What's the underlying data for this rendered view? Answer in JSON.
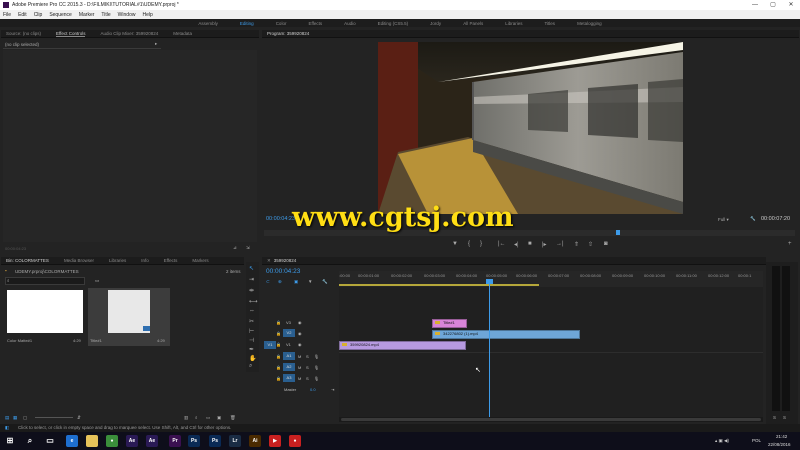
{
  "window": {
    "title": "Adobe Premiere Pro CC 2015.3 - D:\\FILMIKI\\TUTORIAL#1\\UDEMY.prproj *",
    "controls": [
      "—",
      "▢",
      "✕"
    ]
  },
  "menu": [
    "File",
    "Edit",
    "Clip",
    "Sequence",
    "Marker",
    "Title",
    "Window",
    "Help"
  ],
  "workspaces": {
    "items": [
      "Assembly",
      "Editing",
      "Color",
      "Effects",
      "Audio",
      "Editing (CS5.5)",
      "Jordy",
      "All Panels",
      "Libraries",
      "Titles",
      "Metalogging"
    ],
    "active": "Editing"
  },
  "source_panel": {
    "tabs": [
      "Source: (no clips)",
      "Effect Controls",
      "Audio Clip Mixer: 359920824",
      "Metadata"
    ],
    "active_tab": "Effect Controls",
    "no_clip": "(no clip selected)",
    "timecode": "00:00:04:23"
  },
  "program_panel": {
    "title": "Program: 359920824",
    "timecode_left": "00:00:04:23",
    "fit": "Full",
    "timecode_right": "00:00:07:20",
    "playhead_fraction": 0.667
  },
  "watermark": "www.cgtsj.com",
  "project_panel": {
    "tabs": [
      "Bin: COLORMATTES",
      "Media Browser",
      "Libraries",
      "Info",
      "Effects",
      "Markers"
    ],
    "active_tab": "Bin: COLORMATTES",
    "path": "UDEMY.prproj\\COLORMATTES",
    "count": "2 items",
    "items": [
      {
        "name": "Color Matte#1",
        "duration": "4:29"
      },
      {
        "name": "Title#1",
        "duration": "4:29"
      }
    ]
  },
  "timeline": {
    "sequence_tab": "359920824",
    "timecode": "00:00:04:23",
    "ruler": [
      ":00:00",
      "00:00:01:00",
      "00:00:02:00",
      "00:00:03:00",
      "00:00:04:00",
      "00:00:05:00",
      "00:00:06:00",
      "00:00:07:00",
      "00:00:08:00",
      "00:00:09:00",
      "00:00:10:00",
      "00:00:11:00",
      "00:00:12:00",
      "00:00:1"
    ],
    "video_tracks": [
      "V3",
      "V2",
      "V1"
    ],
    "audio_tracks": [
      "A1",
      "A2",
      "A3"
    ],
    "source_patch": "V1",
    "master_label": "Master",
    "master_value": "0.0",
    "clips": [
      {
        "name": "Title#1",
        "track": "V3",
        "color": "#d884d8"
      },
      {
        "name": "342276802 (1).mp4",
        "track": "V2",
        "color": "#6ea6d8"
      },
      {
        "name": "359920824.mp4",
        "track": "V1",
        "color": "#b79ae0"
      }
    ]
  },
  "status_bar": "Click to select, or click in empty space and drag to marquee select. Use Shift, Alt, and Ctrl for other options.",
  "meters": [
    "S",
    "S"
  ],
  "taskbar": {
    "lang": "POL",
    "time": "21:42",
    "date": "22/08/2016",
    "apps": [
      {
        "label": "e",
        "color": "#1e6fd0"
      },
      {
        "label": "",
        "color": "#e6c35a"
      },
      {
        "label": "●",
        "color": "#3b8f3b"
      },
      {
        "label": "Ae",
        "color": "#2a1a55"
      },
      {
        "label": "Ae",
        "color": "#2a1a55"
      },
      {
        "label": "Pr",
        "color": "#3a1050"
      },
      {
        "label": "Ps",
        "color": "#0a2a55"
      },
      {
        "label": "Ps",
        "color": "#0a2a55"
      },
      {
        "label": "Lr",
        "color": "#1a2c44"
      },
      {
        "label": "Ai",
        "color": "#4a2a00"
      },
      {
        "label": "▶",
        "color": "#c82020"
      },
      {
        "label": "●",
        "color": "#c82020"
      }
    ]
  }
}
